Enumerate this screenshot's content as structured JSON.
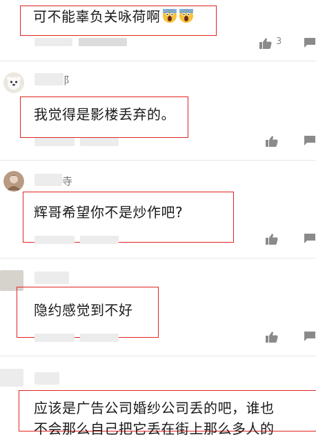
{
  "comments": [
    {
      "text": "可不能辜负关咏荷啊",
      "emoji_count": 2,
      "emoji_name": "screaming-face-icon",
      "like_count": "3",
      "username_fragment": ""
    },
    {
      "text": "我觉得是影楼丢弃的。",
      "like_count": "",
      "username_fragment": "阝"
    },
    {
      "text": "辉哥希望你不是炒作吧?",
      "like_count": "",
      "username_fragment": "寺"
    },
    {
      "text": "隐约感觉到不好",
      "like_count": "",
      "username_fragment": ""
    },
    {
      "text_line1": "应该是广告公司婚纱公司丢的吧，谁也",
      "text_line2": "不会那么自己把它丢在街上那么多人的",
      "like_count": "",
      "username_fragment": ""
    }
  ],
  "colors": {
    "highlight": "#e0221f",
    "icon": "#8a8a8a",
    "divider": "#e6e6e6"
  }
}
